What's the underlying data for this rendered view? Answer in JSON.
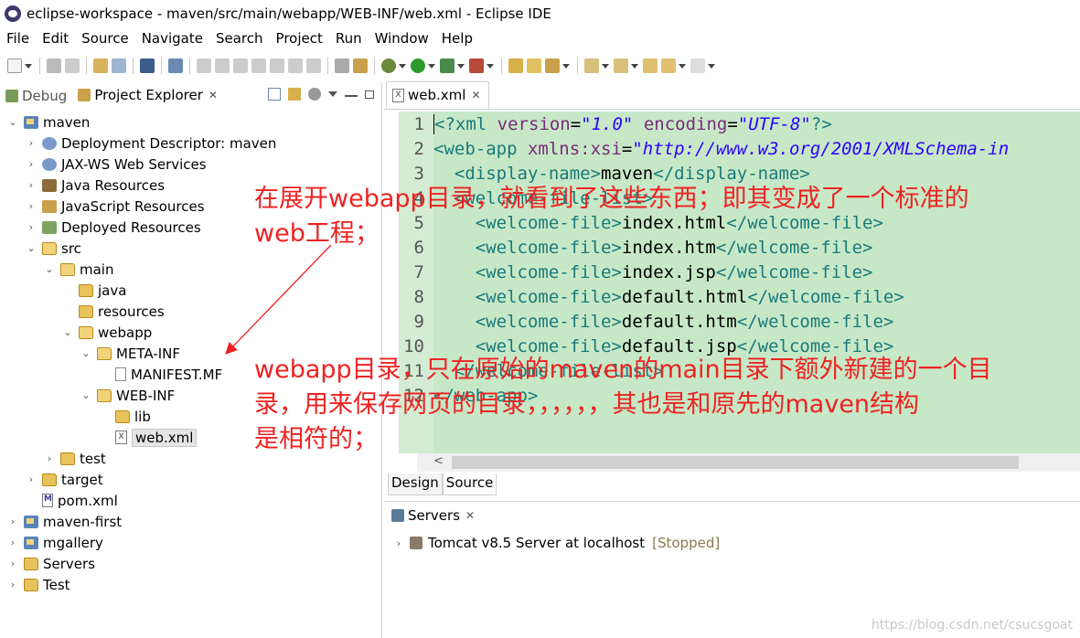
{
  "window": {
    "title": "eclipse-workspace - maven/src/main/webapp/WEB-INF/web.xml - Eclipse IDE"
  },
  "menu": [
    "File",
    "Edit",
    "Source",
    "Navigate",
    "Search",
    "Project",
    "Run",
    "Window",
    "Help"
  ],
  "left_panel": {
    "tabs": [
      {
        "label": "Debug",
        "active": false
      },
      {
        "label": "Project Explorer",
        "active": true
      }
    ],
    "tree": [
      {
        "label": "maven",
        "depth": 0,
        "expanded": true,
        "icon": "project-icon"
      },
      {
        "label": "Deployment Descriptor: maven",
        "depth": 1,
        "expanded": false,
        "icon": "deployment-descriptor-icon"
      },
      {
        "label": "JAX-WS Web Services",
        "depth": 1,
        "expanded": false,
        "icon": "jaxws-icon"
      },
      {
        "label": "Java Resources",
        "depth": 1,
        "expanded": false,
        "icon": "java-resources-icon"
      },
      {
        "label": "JavaScript Resources",
        "depth": 1,
        "expanded": false,
        "icon": "javascript-resources-icon"
      },
      {
        "label": "Deployed Resources",
        "depth": 1,
        "expanded": false,
        "icon": "deployed-resources-icon"
      },
      {
        "label": "src",
        "depth": 1,
        "expanded": true,
        "icon": "folder-open-icon"
      },
      {
        "label": "main",
        "depth": 2,
        "expanded": true,
        "icon": "folder-open-icon"
      },
      {
        "label": "java",
        "depth": 3,
        "expanded": null,
        "icon": "folder-icon"
      },
      {
        "label": "resources",
        "depth": 3,
        "expanded": null,
        "icon": "folder-icon"
      },
      {
        "label": "webapp",
        "depth": 3,
        "expanded": true,
        "icon": "folder-open-icon"
      },
      {
        "label": "META-INF",
        "depth": 4,
        "expanded": true,
        "icon": "folder-open-icon"
      },
      {
        "label": "MANIFEST.MF",
        "depth": 5,
        "expanded": null,
        "icon": "file-icon"
      },
      {
        "label": "WEB-INF",
        "depth": 4,
        "expanded": true,
        "icon": "folder-open-icon"
      },
      {
        "label": "lib",
        "depth": 5,
        "expanded": null,
        "icon": "folder-icon"
      },
      {
        "label": "web.xml",
        "depth": 5,
        "expanded": null,
        "icon": "xml-file-icon",
        "selected": true
      },
      {
        "label": "test",
        "depth": 2,
        "expanded": false,
        "icon": "folder-icon"
      },
      {
        "label": "target",
        "depth": 1,
        "expanded": false,
        "icon": "folder-icon"
      },
      {
        "label": "pom.xml",
        "depth": 1,
        "expanded": null,
        "icon": "pom-file-icon"
      },
      {
        "label": "maven-first",
        "depth": 0,
        "expanded": false,
        "icon": "project-icon"
      },
      {
        "label": "mgallery",
        "depth": 0,
        "expanded": false,
        "icon": "project-icon"
      },
      {
        "label": "Servers",
        "depth": 0,
        "expanded": false,
        "icon": "folder-icon"
      },
      {
        "label": "Test",
        "depth": 0,
        "expanded": false,
        "icon": "folder-icon"
      }
    ]
  },
  "editor": {
    "tab_label": "web.xml",
    "lines": [
      {
        "n": "1",
        "parts": [
          [
            "tag",
            "<?xml "
          ],
          [
            "attr",
            "version"
          ],
          [
            "txt",
            "="
          ],
          [
            "val",
            "\"1.0\""
          ],
          [
            "txt",
            " "
          ],
          [
            "attr",
            "encoding"
          ],
          [
            "txt",
            "="
          ],
          [
            "val",
            "\"UTF-8\""
          ],
          [
            "tag",
            "?>"
          ]
        ]
      },
      {
        "n": "2",
        "parts": [
          [
            "tag",
            "<web-app "
          ],
          [
            "attr",
            "xmlns:xsi"
          ],
          [
            "txt",
            "="
          ],
          [
            "val",
            "\"http://www.w3.org/2001/XMLSchema-in"
          ]
        ]
      },
      {
        "n": "3",
        "parts": [
          [
            "txt",
            "  "
          ],
          [
            "tag",
            "<display-name>"
          ],
          [
            "txt",
            "maven"
          ],
          [
            "tag",
            "</display-name>"
          ]
        ]
      },
      {
        "n": "4",
        "parts": [
          [
            "txt",
            "  "
          ],
          [
            "tag",
            "<welcome-file-list>"
          ]
        ]
      },
      {
        "n": "5",
        "parts": [
          [
            "txt",
            "    "
          ],
          [
            "tag",
            "<welcome-file>"
          ],
          [
            "txt",
            "index.html"
          ],
          [
            "tag",
            "</welcome-file>"
          ]
        ]
      },
      {
        "n": "6",
        "parts": [
          [
            "txt",
            "    "
          ],
          [
            "tag",
            "<welcome-file>"
          ],
          [
            "txt",
            "index.htm"
          ],
          [
            "tag",
            "</welcome-file>"
          ]
        ]
      },
      {
        "n": "7",
        "parts": [
          [
            "txt",
            "    "
          ],
          [
            "tag",
            "<welcome-file>"
          ],
          [
            "txt",
            "index.jsp"
          ],
          [
            "tag",
            "</welcome-file>"
          ]
        ]
      },
      {
        "n": "8",
        "parts": [
          [
            "txt",
            "    "
          ],
          [
            "tag",
            "<welcome-file>"
          ],
          [
            "txt",
            "default.html"
          ],
          [
            "tag",
            "</welcome-file>"
          ]
        ]
      },
      {
        "n": "9",
        "parts": [
          [
            "txt",
            "    "
          ],
          [
            "tag",
            "<welcome-file>"
          ],
          [
            "txt",
            "default.htm"
          ],
          [
            "tag",
            "</welcome-file>"
          ]
        ]
      },
      {
        "n": "10",
        "parts": [
          [
            "txt",
            "    "
          ],
          [
            "tag",
            "<welcome-file>"
          ],
          [
            "txt",
            "default.jsp"
          ],
          [
            "tag",
            "</welcome-file>"
          ]
        ]
      },
      {
        "n": "11",
        "parts": [
          [
            "txt",
            "  "
          ],
          [
            "tag",
            "</welcome-file-list>"
          ]
        ]
      },
      {
        "n": "12",
        "parts": [
          [
            "tag",
            "</web-app>"
          ]
        ]
      }
    ],
    "bottom_tabs": [
      {
        "label": "Design",
        "active": false
      },
      {
        "label": "Source",
        "active": true
      }
    ]
  },
  "servers_panel": {
    "tab_label": "Servers",
    "server_name": "Tomcat v8.5 Server at localhost",
    "server_status": "[Stopped]"
  },
  "annotations": {
    "first": [
      "在展开webapp目录，就看到了这些东西；即其变成了一个标准的",
      "web工程；"
    ],
    "second": [
      "webapp目录，只在原始的maven的main目录下额外新建的一个目",
      "录，用来保存网页的目录，，，，，，其也是和原先的maven结构",
      "是相符的；"
    ]
  },
  "watermark": "https://blog.csdn.net/csucsgoat"
}
